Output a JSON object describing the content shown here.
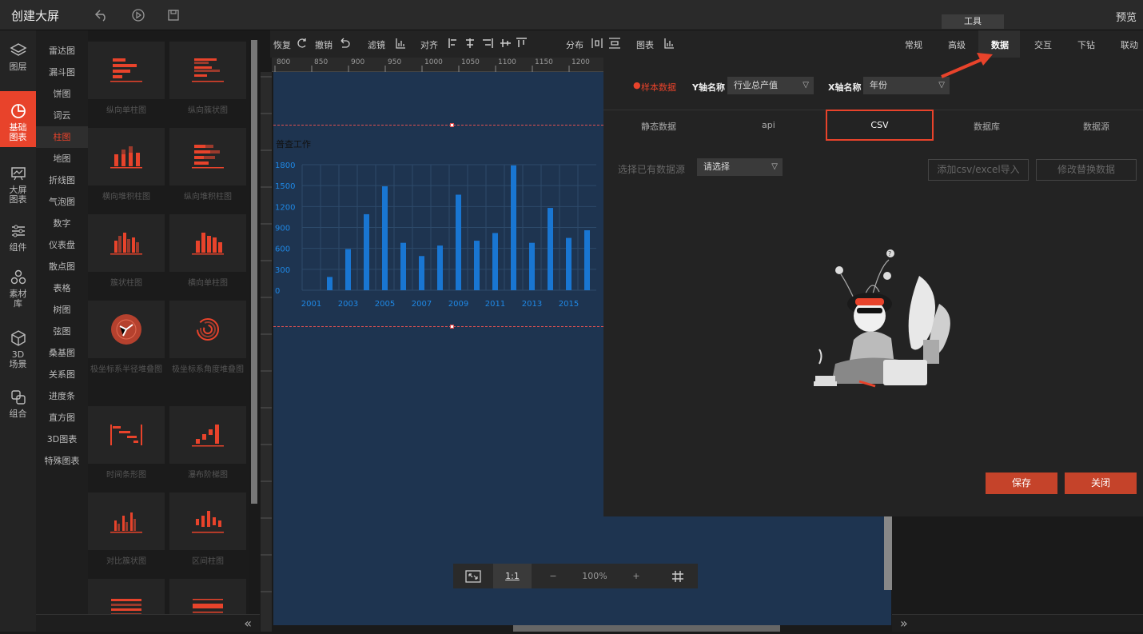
{
  "app": {
    "title": "创建大屏",
    "preview": "预览",
    "tool_tab": "工具"
  },
  "leftnav": [
    {
      "label_1": "图层",
      "label_2": "",
      "label_3": "",
      "icon": "layers-icon"
    },
    {
      "label_1": "基础",
      "label_2": "图表",
      "label_3": "",
      "icon": "pie-chart-icon",
      "active": true
    },
    {
      "label_1": "大屏",
      "label_2": "图表",
      "label_3": "",
      "icon": "presentation-icon"
    },
    {
      "label_1": "组件",
      "label_2": "",
      "label_3": "",
      "icon": "sliders-icon"
    },
    {
      "label_1": "素材",
      "label_2": "库",
      "label_3": "",
      "icon": "cubes-icon"
    },
    {
      "label_1": "3D",
      "label_2": "场景",
      "label_3": "",
      "icon": "cube-3d-icon"
    },
    {
      "label_1": "组合",
      "label_2": "",
      "label_3": "",
      "icon": "group-icon"
    }
  ],
  "categories": [
    "雷达图",
    "漏斗图",
    "饼图",
    "词云",
    "柱图",
    "地图",
    "折线图",
    "气泡图",
    "数字",
    "仪表盘",
    "散点图",
    "表格",
    "树图",
    "弦图",
    "桑基图",
    "关系图",
    "进度条",
    "直方图",
    "3D图表",
    "特殊图表"
  ],
  "gallery": [
    "纵向单柱图",
    "纵向簇状图",
    "横向堆积柱图",
    "纵向堆积柱图",
    "簇状柱图",
    "横向单柱图",
    "极坐标系半径堆叠图",
    "极坐标系角度堆叠图",
    "时间条形图",
    "瀑布阶梯图",
    "对比簇状图",
    "区间柱图"
  ],
  "toolbar": {
    "restore": "恢复",
    "undo": "撤销",
    "filter": "滤镜",
    "align": "对齐",
    "distribute": "分布",
    "chart": "图表"
  },
  "ruler": {
    "h": [
      "800",
      "850",
      "900",
      "950",
      "1000",
      "1050",
      "1100",
      "1150",
      "1200"
    ]
  },
  "canvas_chart": {
    "title": "普查工作",
    "zoom": "100%",
    "ratio": "1:1"
  },
  "chart_data": {
    "type": "bar",
    "title": "普查工作",
    "x": [
      "2001",
      "2002",
      "2003",
      "2004",
      "2005",
      "2006",
      "2007",
      "2008",
      "2009",
      "2010",
      "2011",
      "2012",
      "2013",
      "2014",
      "2015",
      "2016"
    ],
    "x_tick_labels": [
      "2001",
      "2003",
      "2005",
      "2007",
      "2009",
      "2011",
      "2013",
      "2015"
    ],
    "values": [
      0,
      190,
      590,
      1090,
      1490,
      680,
      490,
      640,
      1370,
      710,
      820,
      1790,
      680,
      1180,
      750,
      860
    ],
    "yticks": [
      "1800",
      "1500",
      "1200",
      "900",
      "600",
      "300",
      "0"
    ],
    "ylim": [
      0,
      1800
    ],
    "grid": true,
    "color": "#1976d2"
  },
  "right_panel": {
    "tabs": [
      "常规",
      "高级",
      "数据",
      "交互",
      "下钻",
      "联动"
    ],
    "active_tab": "数据",
    "sample_data": "样本数据",
    "y_axis_label": "Y轴名称",
    "y_axis_value": "行业总产值",
    "x_axis_label": "X轴名称",
    "x_axis_value": "年份",
    "subtabs": [
      "静态数据",
      "api",
      "CSV",
      "数据库",
      "数据源"
    ],
    "datasource_label": "选择已有数据源",
    "datasource_placeholder": "请选择",
    "import_btn": "添加csv/excel导入",
    "modify_btn": "修改替换数据",
    "save": "保存",
    "close": "关闭"
  },
  "colors": {
    "accent": "#e8432b",
    "canvas_bg": "#1e3450",
    "bar": "#1976d2"
  }
}
